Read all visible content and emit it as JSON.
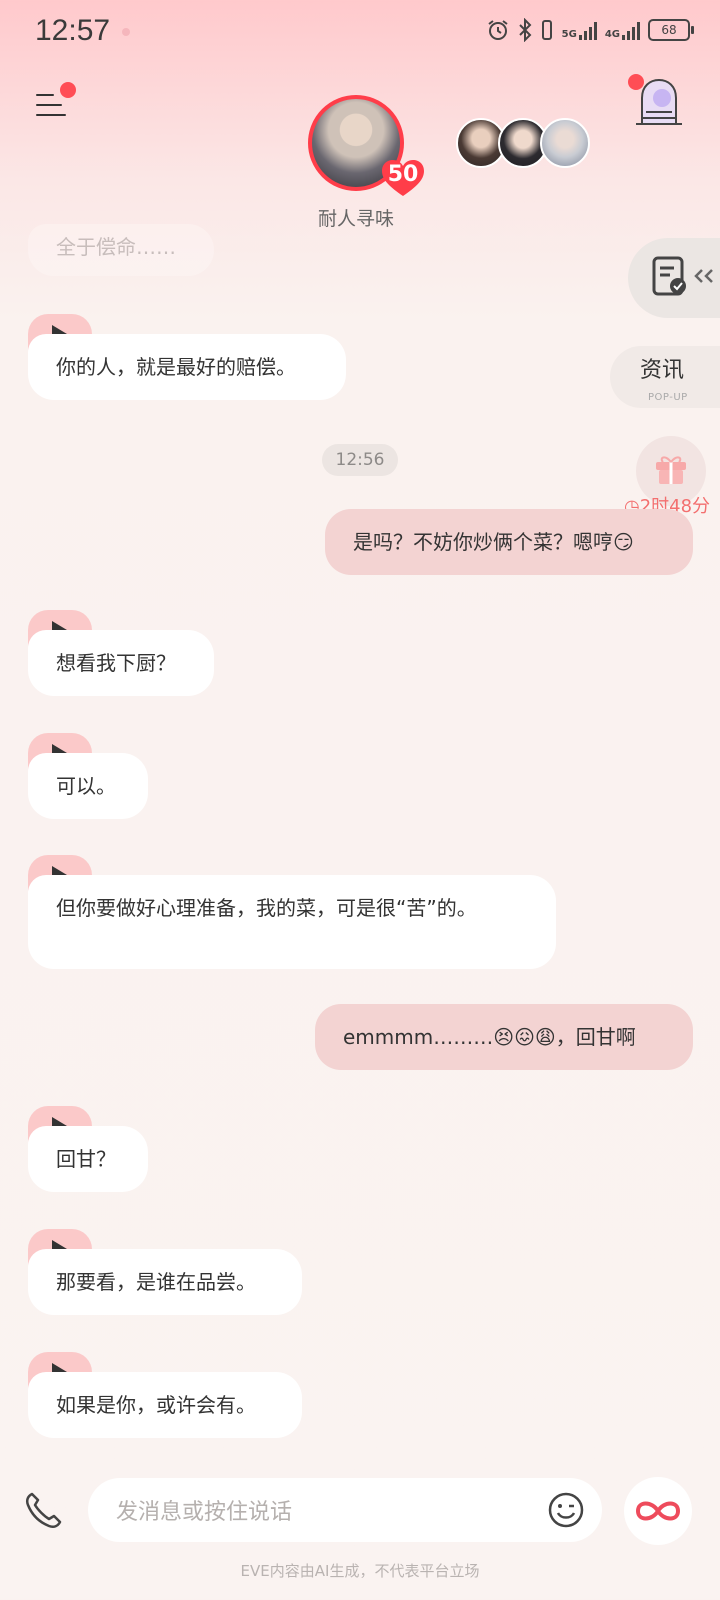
{
  "status_bar": {
    "time": "12:57",
    "battery": "68",
    "net1": "5G",
    "net2": "4G"
  },
  "header": {
    "character_name": "耐人寻味",
    "level": "50"
  },
  "side": {
    "news_label": "资讯",
    "news_sub": "POP-UP",
    "gift_timer": "◷2时48分"
  },
  "messages": {
    "faded_top": "全于偿命……",
    "m1": "你的人，就是最好的赔偿。",
    "time_divider": "12:56",
    "m2": "是吗？不妨你炒俩个菜？嗯哼😏",
    "m3": "想看我下厨？",
    "m4": "可以。",
    "m5": "但你要做好心理准备，我的菜，可是很“苦”的。",
    "m6": "emmmm………😣😖😩，回甘啊",
    "m7": "回甘？",
    "m8": "那要看，是谁在品尝。",
    "m9": "如果是你，或许会有。"
  },
  "input": {
    "placeholder": "发消息或按住说话"
  },
  "footer": {
    "disclaimer": "EVE内容由AI生成，不代表平台立场"
  },
  "colors": {
    "accent": "#ff3d49",
    "outgoing_bubble": "#f3d3d2",
    "play_tab": "#fbc9c9"
  }
}
